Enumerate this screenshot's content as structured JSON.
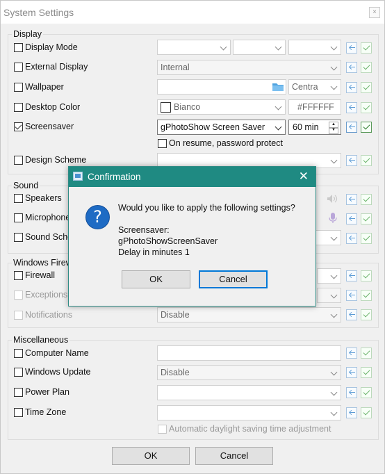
{
  "window": {
    "title": "System Settings",
    "close": "×"
  },
  "display": {
    "group_label": "Display",
    "display_mode": {
      "label": "Display Mode",
      "checked": false
    },
    "external_display": {
      "label": "External Display",
      "checked": false,
      "value": "Internal"
    },
    "wallpaper": {
      "label": "Wallpaper",
      "checked": false,
      "position": "Centra"
    },
    "desktop_color": {
      "label": "Desktop Color",
      "checked": false,
      "color_name": "Bianco",
      "hex": "#FFFFFF"
    },
    "screensaver": {
      "label": "Screensaver",
      "checked": true,
      "value": "gPhotoShow Screen Saver",
      "delay": "60 min",
      "on_resume": "On resume, password protect"
    },
    "design_scheme": {
      "label": "Design Scheme",
      "checked": false
    }
  },
  "sound": {
    "group_label": "Sound",
    "speakers": {
      "label": "Speakers"
    },
    "microphone": {
      "label": "Microphone"
    },
    "sound_scheme": {
      "label": "Sound Sche"
    }
  },
  "firewall": {
    "group_label": "Windows Firew",
    "firewall": {
      "label": "Firewall"
    },
    "exceptions": {
      "label": "Exceptions"
    },
    "notifications": {
      "label": "Notifications",
      "value": "Disable"
    }
  },
  "misc": {
    "group_label": "Miscellaneous",
    "computer_name": {
      "label": "Computer Name"
    },
    "windows_update": {
      "label": "Windows Update",
      "value": "Disable"
    },
    "power_plan": {
      "label": "Power Plan"
    },
    "time_zone": {
      "label": "Time Zone"
    },
    "daylight": "Automatic daylight saving time adjustment"
  },
  "footer": {
    "ok": "OK",
    "cancel": "Cancel"
  },
  "dialog": {
    "title": "Confirmation",
    "close": "✕",
    "question": "Would you like to apply the following settings?",
    "line1": "Screensaver:",
    "line2": "gPhotoShowScreenSaver",
    "line3": "Delay in minutes 1",
    "ok": "OK",
    "cancel": "Cancel"
  },
  "colors": {
    "dialog_title_bg": "#1f8a82",
    "default_button_border": "#0078d7",
    "question_icon": "#1e6bc4"
  }
}
